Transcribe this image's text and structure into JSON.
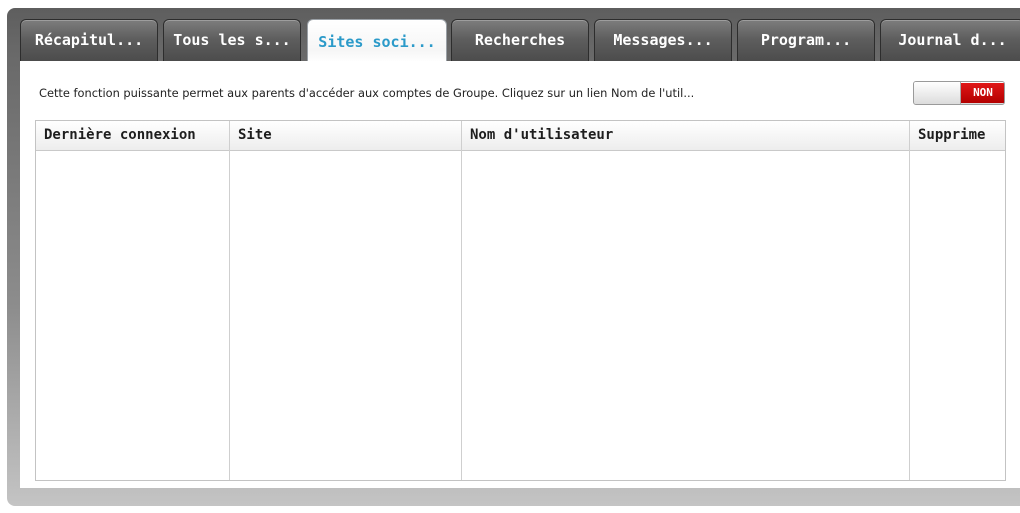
{
  "tabs": [
    {
      "label": "Récapitul...",
      "active": false
    },
    {
      "label": "Tous les s...",
      "active": false
    },
    {
      "label": "Sites soci...",
      "active": true
    },
    {
      "label": "Recherches",
      "active": false
    },
    {
      "label": "Messages...",
      "active": false
    },
    {
      "label": "Program...",
      "active": false
    },
    {
      "label": "Journal d...",
      "active": false
    }
  ],
  "panel": {
    "description": "Cette fonction puissante permet aux parents d'accéder aux comptes de Groupe. Cliquez sur un lien Nom de l'util...",
    "toggle": {
      "state_label": "NON",
      "state_color": "#cc0000"
    }
  },
  "grid": {
    "columns": [
      "Dernière connexion",
      "Site",
      "Nom d'utilisateur",
      "Supprime"
    ],
    "rows": []
  },
  "colors": {
    "active_tab_text": "#2b9ac9",
    "frame": "#6a6a6a"
  }
}
